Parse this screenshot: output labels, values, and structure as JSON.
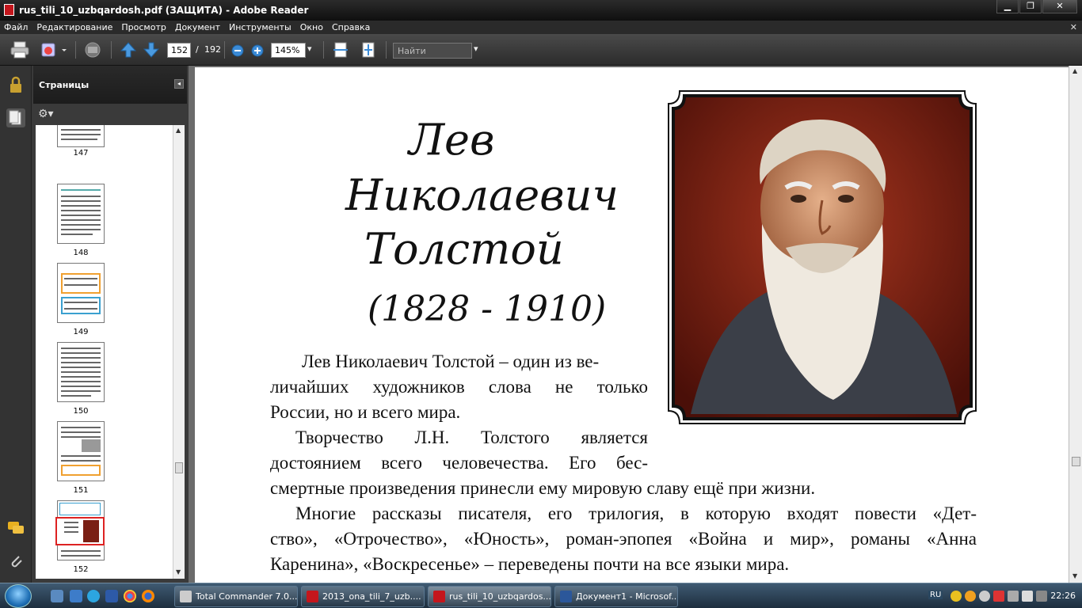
{
  "window": {
    "title": "rus_tili_10_uzbqardosh.pdf (ЗАЩИТА) - Adobe Reader",
    "minimize": "▁",
    "restore": "❐",
    "close": "✕"
  },
  "menu": {
    "items": [
      "Файл",
      "Редактирование",
      "Просмотр",
      "Документ",
      "Инструменты",
      "Окно",
      "Справка"
    ],
    "close_glyph": "✕"
  },
  "toolbar": {
    "current_page": "152",
    "page_separator": "/",
    "total_pages": "192",
    "zoom": "145%",
    "find_placeholder": "Найти",
    "dropdown_glyph": "▾"
  },
  "pages_panel": {
    "title": "Страницы",
    "collapse_glyph": "◂",
    "options_glyph": "⚙▾",
    "thumbnails": [
      {
        "num": "147"
      },
      {
        "num": "148"
      },
      {
        "num": "149"
      },
      {
        "num": "150"
      },
      {
        "num": "151"
      },
      {
        "num": "152"
      }
    ]
  },
  "document": {
    "heading_line1": "Лев",
    "heading_line2": "Николаевич",
    "heading_line3": "Толстой",
    "heading_years": "(1828 - 1910)",
    "para1_line1": "Лев Николаевич Толстой – один из ве-",
    "para1_line2": "личайших художников слова не только",
    "para1_line3": "России, но и всего мира.",
    "para2_line1": "Творчество Л.Н. Толстого является",
    "para2_line2": "достоянием всего человечества. Его бес-",
    "para2_line3": "смертные произведения принесли ему мировую славу ещё при жизни.",
    "para3_line1": "Многие рассказы писателя, его трилогия, в которую входят повести «Дет-",
    "para3_line2": "ство», «Отрочество», «Юность», роман-эпопея «Война и мир», романы «Анна",
    "para3_line3": "Каренина», «Воскресенье» – переведены почти на все языки мира."
  },
  "taskbar": {
    "buttons": [
      {
        "label": "Total Commander 7.0..."
      },
      {
        "label": "2013_ona_tili_7_uzb...."
      },
      {
        "label": "rus_tili_10_uzbqardos..."
      },
      {
        "label": "Документ1 - Microsof..."
      }
    ],
    "language": "RU",
    "time": "22:26"
  },
  "colors": {
    "pdf_red": "#c4161c",
    "word_blue": "#2b579a",
    "frame_dark": "#1a1a1a",
    "portrait_bg": "#7a1f14"
  }
}
